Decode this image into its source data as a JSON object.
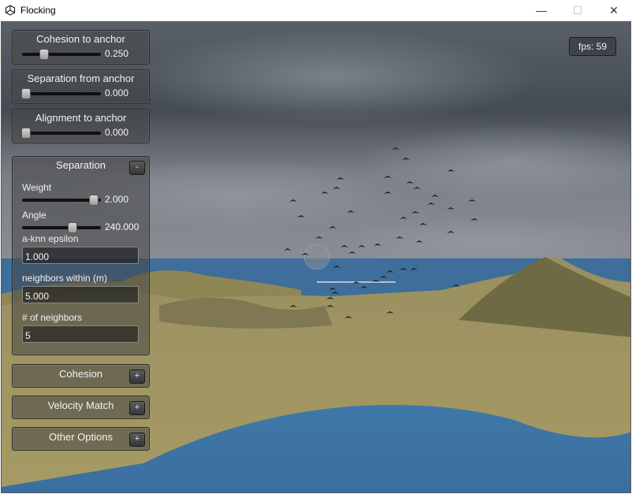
{
  "window": {
    "title": "Flocking",
    "minimize": "—",
    "maximize": "☐",
    "close": "✕"
  },
  "sliders": [
    {
      "label": "Cohesion to anchor",
      "value": "0.250",
      "fraction": 0.25
    },
    {
      "label": "Separation from anchor",
      "value": "0.000",
      "fraction": 0.0
    },
    {
      "label": "Alignment to anchor",
      "value": "0.000",
      "fraction": 0.0
    }
  ],
  "separation": {
    "title": "Separation",
    "toggle": "-",
    "weight_label": "Weight",
    "weight_value": "2.000",
    "weight_fraction": 0.95,
    "angle_label": "Angle",
    "angle_value": "240.000",
    "angle_fraction": 0.66,
    "epsilon_label": "a-knn epsilon",
    "epsilon_value": "1.000",
    "neighbors_within_label": "neighbors within (m)",
    "neighbors_within_value": "5.000",
    "num_neighbors_label": "# of neighbors",
    "num_neighbors_value": "5"
  },
  "collapsed": [
    {
      "title": "Cohesion",
      "toggle": "+"
    },
    {
      "title": "Velocity Match",
      "toggle": "+"
    },
    {
      "title": "Other Options",
      "toggle": "+"
    }
  ],
  "fps": "fps: 59"
}
